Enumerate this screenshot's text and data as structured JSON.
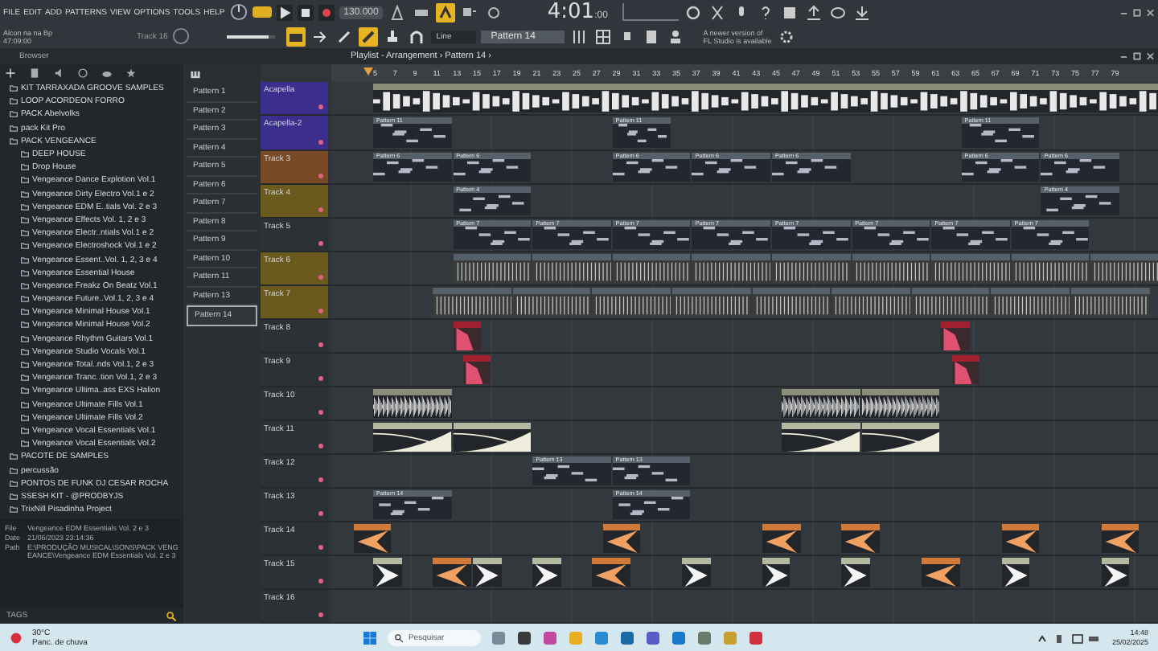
{
  "menu": [
    "FILE",
    "EDIT",
    "ADD",
    "PATTERNS",
    "VIEW",
    "OPTIONS",
    "TOOLS",
    "HELP"
  ],
  "hint": [
    "Alcon na na Bp",
    "47:09:00"
  ],
  "track_label": "Track 16",
  "transport": {
    "pattern_mode": true,
    "tempo": "130.000",
    "time": "4:01",
    "time_small": ":00"
  },
  "master_volume": {
    "level": 0.85
  },
  "pattern_selector": "Pattern 14",
  "snap": "Line",
  "news": [
    "A newer version of",
    "FL Studio is available"
  ],
  "browser": {
    "title": "Browser",
    "items": [
      {
        "label": "KIT TARRAXADA GROOVE SAMPLES"
      },
      {
        "label": "LOOP ACORDEON FORRO"
      },
      {
        "label": "PACK Abelvolks"
      },
      {
        "label": "pack Kit Pro"
      },
      {
        "label": "PACK VENGEANCE",
        "children": [
          {
            "label": "DEEP HOUSE"
          },
          {
            "label": "Drop House"
          },
          {
            "label": "Vengeance Dance Explotion Vol.1"
          },
          {
            "label": "Vengeance Dirty Electro Vol.1 e 2"
          },
          {
            "label": "Vengeance EDM E..tials Vol. 2 e 3"
          },
          {
            "label": "Vengeance Effects Vol. 1, 2 e 3"
          },
          {
            "label": "Vengeance Electr..ntials Vol.1 e 2"
          },
          {
            "label": "Vengeance Electroshock Vol.1 e 2"
          },
          {
            "label": "Vengeance Essent..Vol. 1, 2, 3 e 4"
          },
          {
            "label": "Vengeance Essential House"
          },
          {
            "label": "Vengeance Freakz On Beatz Vol.1"
          },
          {
            "label": "Vengeance Future..Vol.1, 2, 3 e 4"
          },
          {
            "label": "Vengeance Minimal House Vol.1"
          },
          {
            "label": "Vengeance Minimal House Vol.2"
          },
          {
            "label": "Vengeance Rhythm Guitars Vol.1"
          },
          {
            "label": "Vengeance Studio Vocals Vol.1"
          },
          {
            "label": "Vengeance Total..nds Vol.1, 2 e 3"
          },
          {
            "label": "Vengeance Tranc..tion Vol.1, 2 e 3"
          },
          {
            "label": "Vengeance Ultima..ass EXS Halion"
          },
          {
            "label": "Vengeance Ultimate Fills Vol.1"
          },
          {
            "label": "Vengeance Ultimate Fills Vol.2"
          },
          {
            "label": "Vengeance Vocal Essentials Vol.1"
          },
          {
            "label": "Vengeance Vocal Essentials Vol.2"
          }
        ]
      },
      {
        "label": "PACOTE DE SAMPLES"
      },
      {
        "label": "percussão"
      },
      {
        "label": "PONTOS DE FUNK DJ CESAR ROCHA"
      },
      {
        "label": "SSESH KIT - @PRODBYJS"
      },
      {
        "label": "TrixNill Pisadinha Project"
      }
    ]
  },
  "info": [
    {
      "key": "File",
      "value": "Vengeance EDM Essentials Vol. 2 e 3"
    },
    {
      "key": "Date",
      "value": "21/06/2023 23:14:36"
    },
    {
      "key": "Path",
      "value": "E:\\PRODUÇÃO MUSICAL\\SONS\\PACK VENGEANCE\\Vengeance EDM Essentials Vol. 2 e 3"
    }
  ],
  "tags": "TAGS",
  "patterns": [
    {
      "label": "Pattern 1",
      "selected": false
    },
    {
      "label": "Pattern 2",
      "selected": false
    },
    {
      "label": "Pattern 3",
      "selected": false
    },
    {
      "label": "Pattern 4",
      "selected": false
    },
    {
      "label": "Pattern 5",
      "selected": false
    },
    {
      "label": "Pattern 6",
      "selected": false
    },
    {
      "label": "Pattern 7",
      "selected": false
    },
    {
      "label": "Pattern 8",
      "selected": false
    },
    {
      "label": "Pattern 9",
      "selected": false
    },
    {
      "label": "Pattern 10",
      "selected": false
    },
    {
      "label": "Pattern 11",
      "selected": false
    },
    {
      "label": "Pattern 13",
      "selected": false
    },
    {
      "label": "Pattern 14",
      "selected": true
    }
  ],
  "playlist": {
    "title": "Playlist - Arrangement › Pattern 14 ›",
    "ruler": [
      "5",
      "7",
      "9",
      "11",
      "13",
      "15",
      "17",
      "19",
      "21",
      "23",
      "25",
      "27",
      "29",
      "31",
      "33",
      "35",
      "37",
      "39",
      "41",
      "43",
      "45",
      "47",
      "49",
      "51",
      "53",
      "55",
      "57",
      "59",
      "61",
      "63",
      "65",
      "67",
      "69",
      "71",
      "73",
      "75",
      "77",
      "79"
    ],
    "tracks": [
      {
        "name": "Acapella",
        "color": "#3b2e8c",
        "clips": [
          {
            "kind": "audio"
          }
        ]
      },
      {
        "name": "Acapella-2",
        "color": "#3b2e8c",
        "clips": [
          {
            "kind": "pattern",
            "label": "Pattern 11"
          },
          {
            "kind": "pattern",
            "label": "Pattern 11"
          },
          {
            "kind": "pattern",
            "label": "Pattern 11"
          }
        ]
      },
      {
        "name": "Track 3",
        "color": "#7a4a26",
        "clips": [
          {
            "kind": "pattern",
            "label": "Pattern 6"
          },
          {
            "kind": "pattern",
            "label": "Pattern 6"
          },
          {
            "kind": "pattern",
            "label": "Pattern 6"
          },
          {
            "kind": "pattern",
            "label": "Pattern 6"
          },
          {
            "kind": "pattern",
            "label": "Pattern 6"
          },
          {
            "kind": "pattern",
            "label": "Pattern 6"
          },
          {
            "kind": "pattern",
            "label": "Pattern 6"
          }
        ]
      },
      {
        "name": "Track 4",
        "color": "#6b5a1e",
        "clips": [
          {
            "kind": "pattern",
            "label": "Pattern 4"
          },
          {
            "kind": "pattern",
            "label": "Pattern 4"
          }
        ]
      },
      {
        "name": "Track 5",
        "color": "#2c3135",
        "clips": [
          {
            "kind": "pattern",
            "label": "Pattern 7"
          },
          {
            "kind": "pattern",
            "label": "Pattern 7"
          },
          {
            "kind": "pattern",
            "label": "Pattern 7"
          },
          {
            "kind": "pattern",
            "label": "Pattern 7"
          },
          {
            "kind": "pattern",
            "label": "Pattern 7"
          },
          {
            "kind": "pattern",
            "label": "Pattern 7"
          },
          {
            "kind": "pattern",
            "label": "Pattern 7"
          },
          {
            "kind": "pattern",
            "label": "Pattern 7"
          }
        ]
      },
      {
        "name": "Track 6",
        "color": "#6b5a1e",
        "clips": [
          {
            "kind": "lines"
          },
          {
            "kind": "lines"
          },
          {
            "kind": "lines"
          },
          {
            "kind": "lines"
          },
          {
            "kind": "lines"
          },
          {
            "kind": "lines"
          },
          {
            "kind": "lines"
          },
          {
            "kind": "lines"
          },
          {
            "kind": "lines"
          }
        ]
      },
      {
        "name": "Track 7",
        "color": "#6b5a1e",
        "clips": [
          {
            "kind": "lines"
          },
          {
            "kind": "lines"
          },
          {
            "kind": "lines"
          },
          {
            "kind": "lines"
          },
          {
            "kind": "lines"
          },
          {
            "kind": "lines"
          },
          {
            "kind": "lines"
          },
          {
            "kind": "lines"
          },
          {
            "kind": "lines"
          }
        ]
      },
      {
        "name": "Track 8",
        "color": "#2c3135",
        "clips": [
          {
            "kind": "hit_red"
          },
          {
            "kind": "hit_red"
          }
        ]
      },
      {
        "name": "Track 9",
        "color": "#2c3135",
        "clips": [
          {
            "kind": "hit_red"
          },
          {
            "kind": "hit_red"
          }
        ]
      },
      {
        "name": "Track 10",
        "color": "#2c3135",
        "clips": [
          {
            "kind": "audio"
          },
          {
            "kind": "audio"
          },
          {
            "kind": "audio"
          }
        ]
      },
      {
        "name": "Track 11",
        "color": "#2c3135",
        "clips": [
          {
            "kind": "sweep"
          },
          {
            "kind": "sweep"
          },
          {
            "kind": "sweep"
          },
          {
            "kind": "sweep"
          }
        ]
      },
      {
        "name": "Track 12",
        "color": "#2c3135",
        "clips": [
          {
            "kind": "pattern",
            "label": "Pattern 13"
          },
          {
            "kind": "pattern",
            "label": "Pattern 13"
          }
        ]
      },
      {
        "name": "Track 13",
        "color": "#2c3135",
        "clips": [
          {
            "kind": "pattern",
            "label": "Pattern 14"
          },
          {
            "kind": "pattern",
            "label": "Pattern 14"
          }
        ]
      },
      {
        "name": "Track 14",
        "color": "#2c3135",
        "clips": [
          {
            "kind": "sample"
          },
          {
            "kind": "sample"
          },
          {
            "kind": "sample"
          },
          {
            "kind": "sample"
          },
          {
            "kind": "sample"
          },
          {
            "kind": "sample"
          }
        ]
      },
      {
        "name": "Track 15",
        "color": "#2c3135",
        "clips": [
          {
            "kind": "hit"
          },
          {
            "kind": "sample"
          },
          {
            "kind": "hit"
          },
          {
            "kind": "hit"
          },
          {
            "kind": "sample"
          },
          {
            "kind": "hit"
          },
          {
            "kind": "hit"
          },
          {
            "kind": "hit"
          },
          {
            "kind": "sample"
          },
          {
            "kind": "hit"
          },
          {
            "kind": "hit"
          }
        ]
      },
      {
        "name": "Track 16",
        "color": "#2c3135"
      }
    ]
  },
  "taskbar": {
    "weather": [
      "30°C",
      "Panc. de chuva"
    ],
    "search": "Pesquisar",
    "apps": [
      {
        "color": "#7a8a9a"
      },
      {
        "color": "#3a3a3a"
      },
      {
        "color": "#c04aa0"
      },
      {
        "color": "#e8b020"
      },
      {
        "color": "#2a8ad0"
      },
      {
        "color": "#1a6aa8"
      },
      {
        "color": "#5a5ac8"
      },
      {
        "color": "#1a78c8"
      },
      {
        "color": "#6a7a6a"
      },
      {
        "color": "#c8a030"
      },
      {
        "color": "#d03040"
      }
    ],
    "clock": [
      "14:48",
      "25/02/2025"
    ]
  }
}
